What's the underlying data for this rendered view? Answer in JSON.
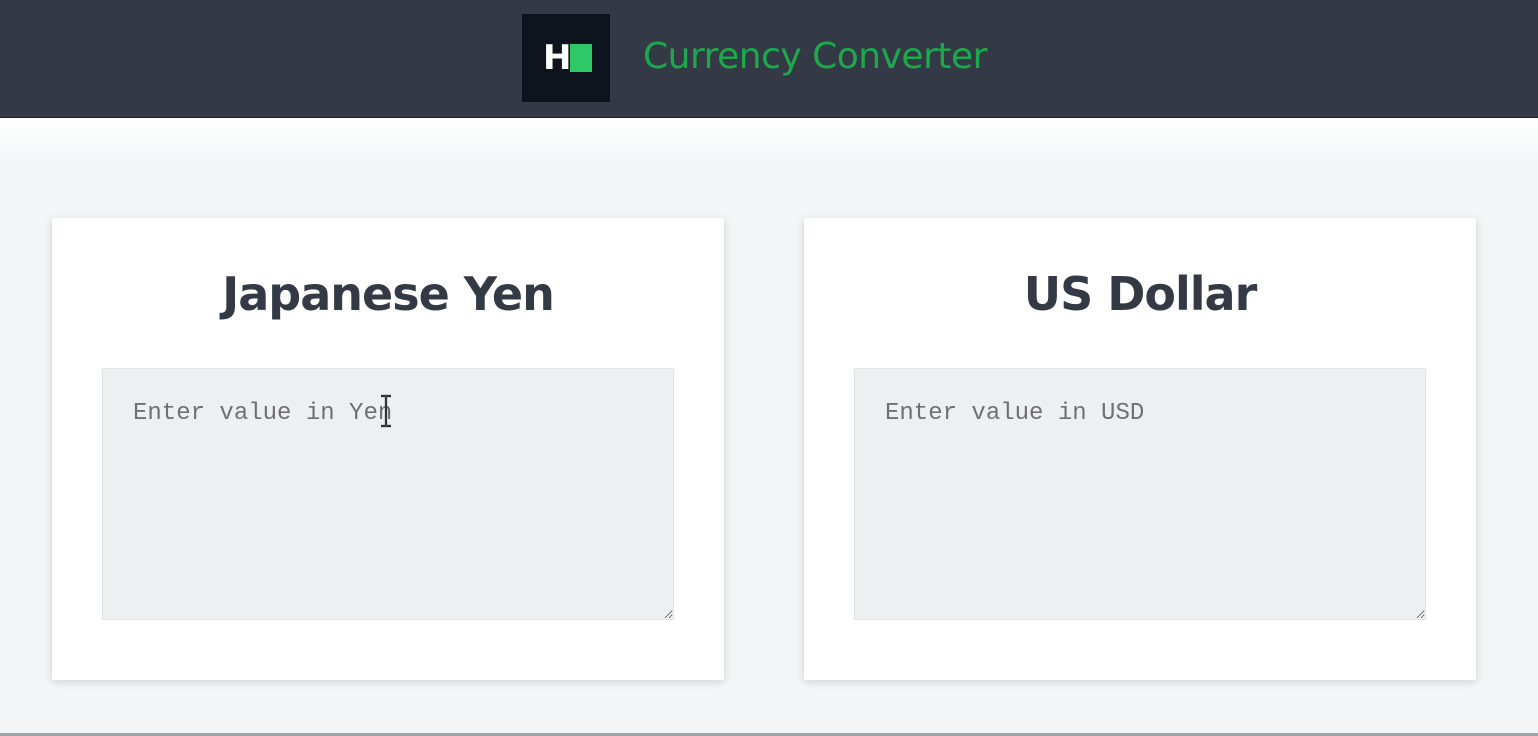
{
  "header": {
    "logo_letter": "H",
    "title": "Currency Converter"
  },
  "converter": {
    "from": {
      "title": "Japanese Yen",
      "value": "",
      "placeholder": "Enter value in Yen"
    },
    "to": {
      "title": "US Dollar",
      "value": "",
      "placeholder": "Enter value in USD"
    }
  },
  "colors": {
    "header_bg": "#343a45",
    "brand_green": "#1ba94c",
    "logo_bg": "#0e141e",
    "logo_accent": "#2ec866",
    "heading_text": "#343a45",
    "input_bg": "#edf0f1"
  },
  "icons": {
    "logo": "hackerrank-logo",
    "cursor": "text-cursor-icon"
  }
}
